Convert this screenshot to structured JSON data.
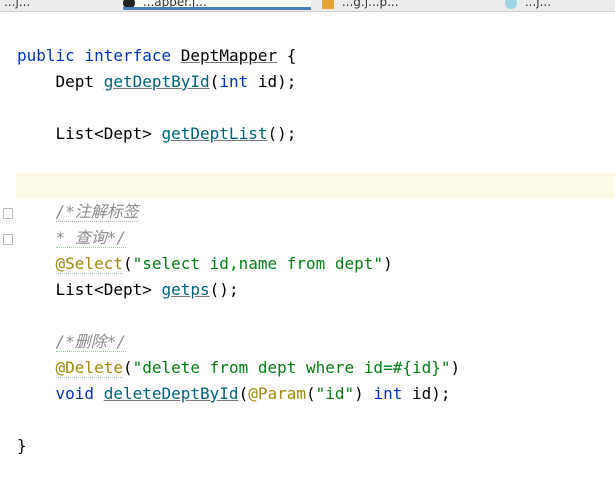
{
  "tabs": [
    {
      "label": "...j..."
    },
    {
      "label": "...apper.j...",
      "active": true
    },
    {
      "label": "...g.j...p..."
    },
    {
      "label": "...j..."
    }
  ],
  "code": {
    "l1": {
      "kw1": "public",
      "kw2": "interface",
      "name": "DeptMapper",
      "brace": "{"
    },
    "l2": {
      "type": "Dept",
      "method": "getDeptById",
      "paren_open": "(",
      "kw": "int",
      "param": "id",
      "end": ");"
    },
    "l3": {
      "type": "List<Dept>",
      "method": "getDeptList",
      "end": "();"
    },
    "l4": {
      "text": "/*注解标签"
    },
    "l5": {
      "text": "* 查询*/"
    },
    "l6": {
      "ann": "@Select",
      "paren_open": "(",
      "str": "\"select id,name from dept\"",
      "paren_close": ")"
    },
    "l7": {
      "type": "List<Dept>",
      "method": "getps",
      "end": "();"
    },
    "l8": {
      "text": "/*删除*/"
    },
    "l9": {
      "ann": "@Delete",
      "paren_open": "(",
      "str": "\"delete from dept where id=#{id}\"",
      "paren_close": ")"
    },
    "l10": {
      "kw": "void",
      "method": "deleteDeptById",
      "paren_open": "(",
      "ann": "@Param",
      "ann_open": "(",
      "str": "\"id\"",
      "ann_close": ")",
      "kw2": "int",
      "param": "id",
      "end": ");"
    },
    "l11": {
      "brace": "}"
    }
  },
  "colors": {
    "keyword": "#0033b3",
    "method": "#00627a",
    "annotation": "#9e880d",
    "string": "#067d17",
    "comment": "#8c8c8c",
    "caret_line": "#fdfaea"
  }
}
